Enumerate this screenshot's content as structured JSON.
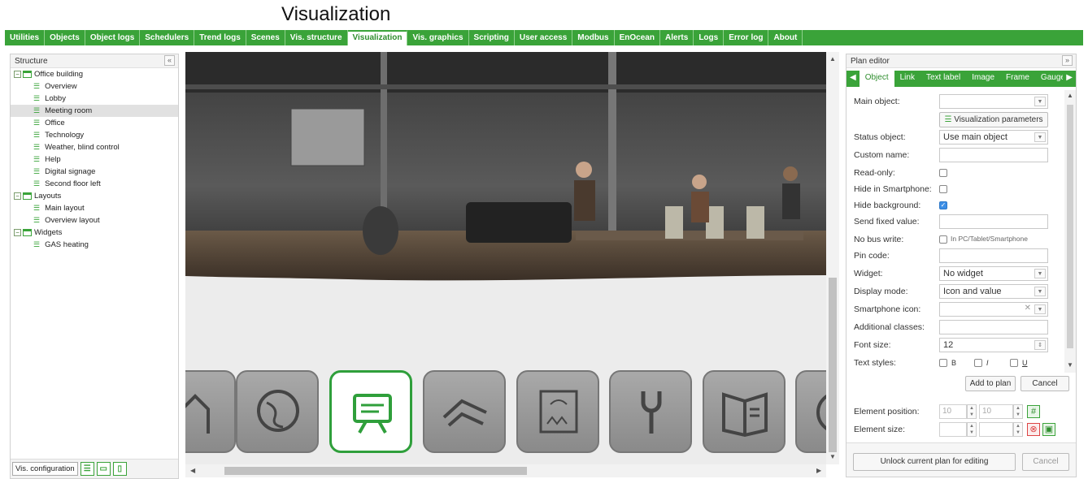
{
  "page_title": "Visualization",
  "nav_tabs": [
    "Utilities",
    "Objects",
    "Object logs",
    "Schedulers",
    "Trend logs",
    "Scenes",
    "Vis. structure",
    "Visualization",
    "Vis. graphics",
    "Scripting",
    "User access",
    "Modbus",
    "EnOcean",
    "Alerts",
    "Logs",
    "Error log",
    "About"
  ],
  "active_tab": "Visualization",
  "structure": {
    "title": "Structure",
    "collapse": "«",
    "tree": [
      {
        "label": "Office building",
        "level": 0
      },
      {
        "label": "Overview",
        "level": 1
      },
      {
        "label": "Lobby",
        "level": 1
      },
      {
        "label": "Meeting room",
        "level": 1,
        "selected": true
      },
      {
        "label": "Office",
        "level": 1
      },
      {
        "label": "Technology",
        "level": 1
      },
      {
        "label": "Weather, blind control",
        "level": 1
      },
      {
        "label": "Help",
        "level": 1
      },
      {
        "label": "Digital signage",
        "level": 1
      },
      {
        "label": "Second floor left",
        "level": 1
      },
      {
        "label": "Layouts",
        "level": 0
      },
      {
        "label": "Main layout",
        "level": 1
      },
      {
        "label": "Overview layout",
        "level": 1
      },
      {
        "label": "Widgets",
        "level": 0
      },
      {
        "label": "GAS heating",
        "level": 1
      }
    ],
    "footer_button": "Vis. configuration"
  },
  "dock_icons": [
    "house-icon",
    "globe-icon",
    "signage-icon",
    "pipes-icon",
    "weather-icon",
    "wrench-icon",
    "book-icon",
    "partial-icon"
  ],
  "plan_editor": {
    "title": "Plan editor",
    "expand": "»",
    "tabs": [
      "Object",
      "Link",
      "Text label",
      "Image",
      "Frame",
      "Gauge"
    ],
    "active_tab": "Object",
    "fields": {
      "main_object": "Main object:",
      "vis_params_button": "Visualization parameters",
      "status_object": "Status object:",
      "status_object_value": "Use main object",
      "custom_name": "Custom name:",
      "read_only": "Read-only:",
      "hide_in_smartphone": "Hide in Smartphone:",
      "hide_background": "Hide background:",
      "send_fixed_value": "Send fixed value:",
      "no_bus_write": "No bus write:",
      "no_bus_write_hint": "In PC/Tablet/Smartphone",
      "pin_code": "Pin code:",
      "widget": "Widget:",
      "widget_value": "No widget",
      "display_mode": "Display mode:",
      "display_mode_value": "Icon and value",
      "smartphone_icon": "Smartphone icon:",
      "additional_classes": "Additional classes:",
      "font_size": "Font size:",
      "font_size_value": "12",
      "text_styles": "Text styles:",
      "style_b": "B",
      "style_i": "I",
      "style_u": "U"
    },
    "add_button": "Add to plan",
    "cancel_button": "Cancel",
    "element_position": "Element position:",
    "pos_x": "10",
    "pos_y": "10",
    "element_size": "Element size:",
    "unlock_button": "Unlock current plan for editing",
    "bottom_cancel": "Cancel"
  }
}
